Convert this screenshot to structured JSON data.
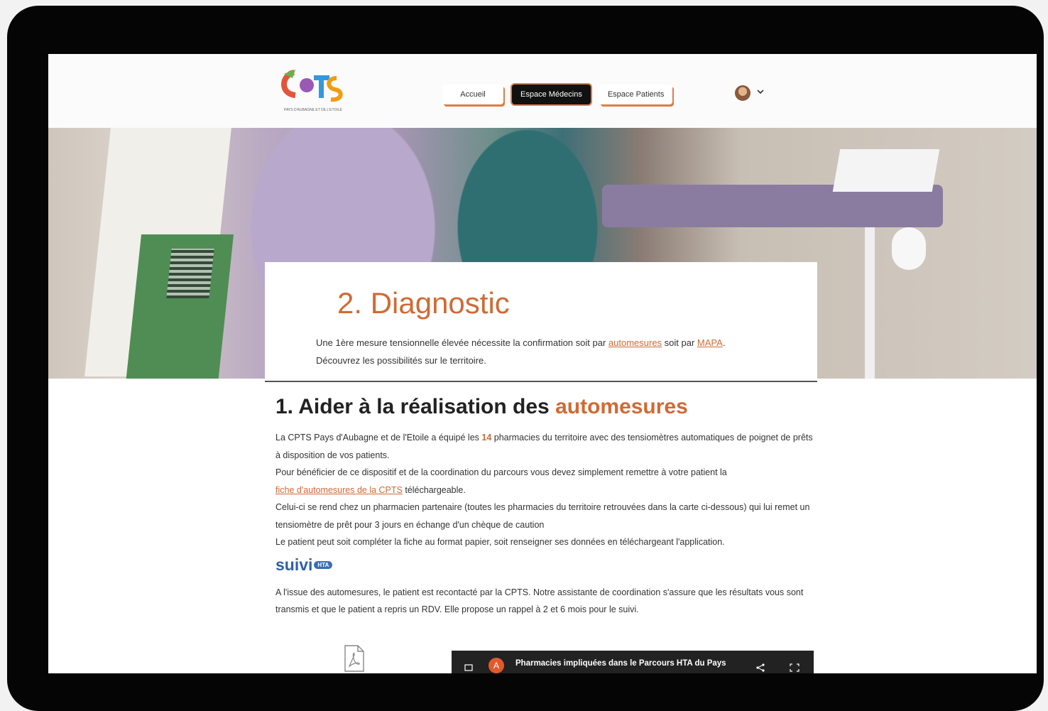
{
  "nav": {
    "items": [
      "Accueil",
      "Espace Médecins",
      "Espace Patients"
    ],
    "active": "Espace Médecins"
  },
  "logo": {
    "text": "CPTS",
    "tagline": "PAYS D'AUBAGNE ET DE L'ETOILE"
  },
  "hero": {
    "title": "2. Diagnostic",
    "text_before": "Une 1ère mesure tensionnelle élevée nécessite la confirmation soit par ",
    "link1": "automesures",
    "text_mid": " soit par ",
    "link2": "MAPA",
    "text_end": ".",
    "line2": "Découvrez les possibilités sur le territoire."
  },
  "section": {
    "title_prefix": "1. Aider à la réalisation des ",
    "title_accent": "automesures",
    "p1_before": "La CPTS Pays d'Aubagne et de l'Etoile a équipé les ",
    "p1_num": "14",
    "p1_after": " pharmacies du territoire avec des tensiomètres automatiques de poignet de prêts à disposition de vos patients.",
    "p2": "Pour bénéficier de ce dispositif et de la coordination du parcours vous devez simplement remettre à votre patient la",
    "p2_link": "fiche d'automesures de la CPTS",
    "p2_after": " téléchargeable.",
    "p3": "Celui-ci se rend chez un pharmacien partenaire (toutes les pharmacies du territoire retrouvées dans la carte ci-dessous) qui lui remet un tensiomètre de prêt pour 3 jours en échange d'un chèque de caution",
    "p4": "Le patient peut soit compléter la fiche au format papier, soit renseigner ses données en téléchargeant l'application.",
    "app_word": "suivi",
    "app_badge": "HTA",
    "p5": "A l'issue des automesures, le patient est recontacté par la CPTS. Notre assistante de coordination s'assure que les résultats vous sont transmis et que le patient a repris un RDV. Elle propose un rappel à 2 et 6 mois pour le suivi."
  },
  "video": {
    "avatar_letter": "A",
    "title": "Pharmacies impliquées dans le Parcours HTA du Pays"
  },
  "colors": {
    "accent": "#d06a34",
    "brand_blue": "#2f5fa8"
  }
}
